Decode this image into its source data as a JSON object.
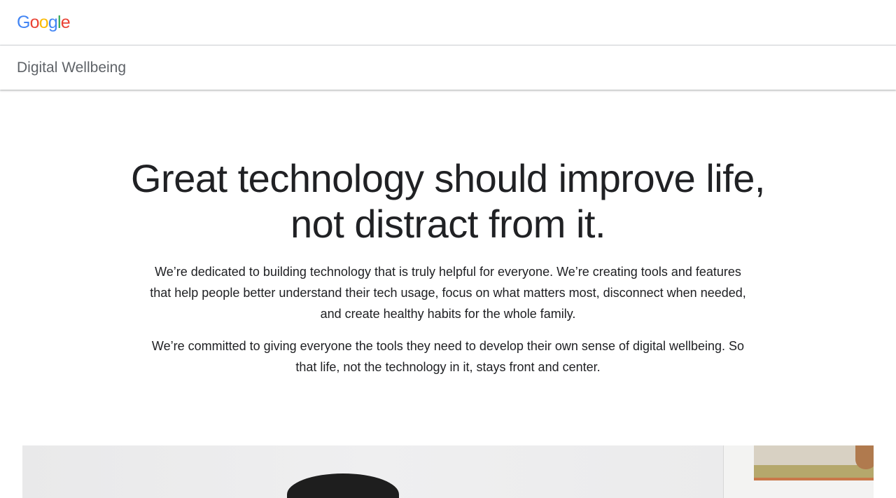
{
  "header": {
    "logo_letters": [
      {
        "char": "G",
        "color": "#4285F4"
      },
      {
        "char": "o",
        "color": "#EA4335"
      },
      {
        "char": "o",
        "color": "#FBBC05"
      },
      {
        "char": "g",
        "color": "#4285F4"
      },
      {
        "char": "l",
        "color": "#34A853"
      },
      {
        "char": "e",
        "color": "#EA4335"
      }
    ]
  },
  "subheader": {
    "product_name": "Digital Wellbeing"
  },
  "hero": {
    "title_line1": "Great technology should improve life,",
    "title_line2": "not distract from it.",
    "paragraph1": "We’re dedicated to building technology that is truly helpful for everyone. We’re creating tools and features that help people better understand their tech usage, focus on what matters most, disconnect when needed, and create healthy habits for the whole family.",
    "paragraph2": "We’re committed to giving everyone the tools they need to develop their own sense of digital wellbeing. So that life, not the technology in it, stays front and center."
  }
}
